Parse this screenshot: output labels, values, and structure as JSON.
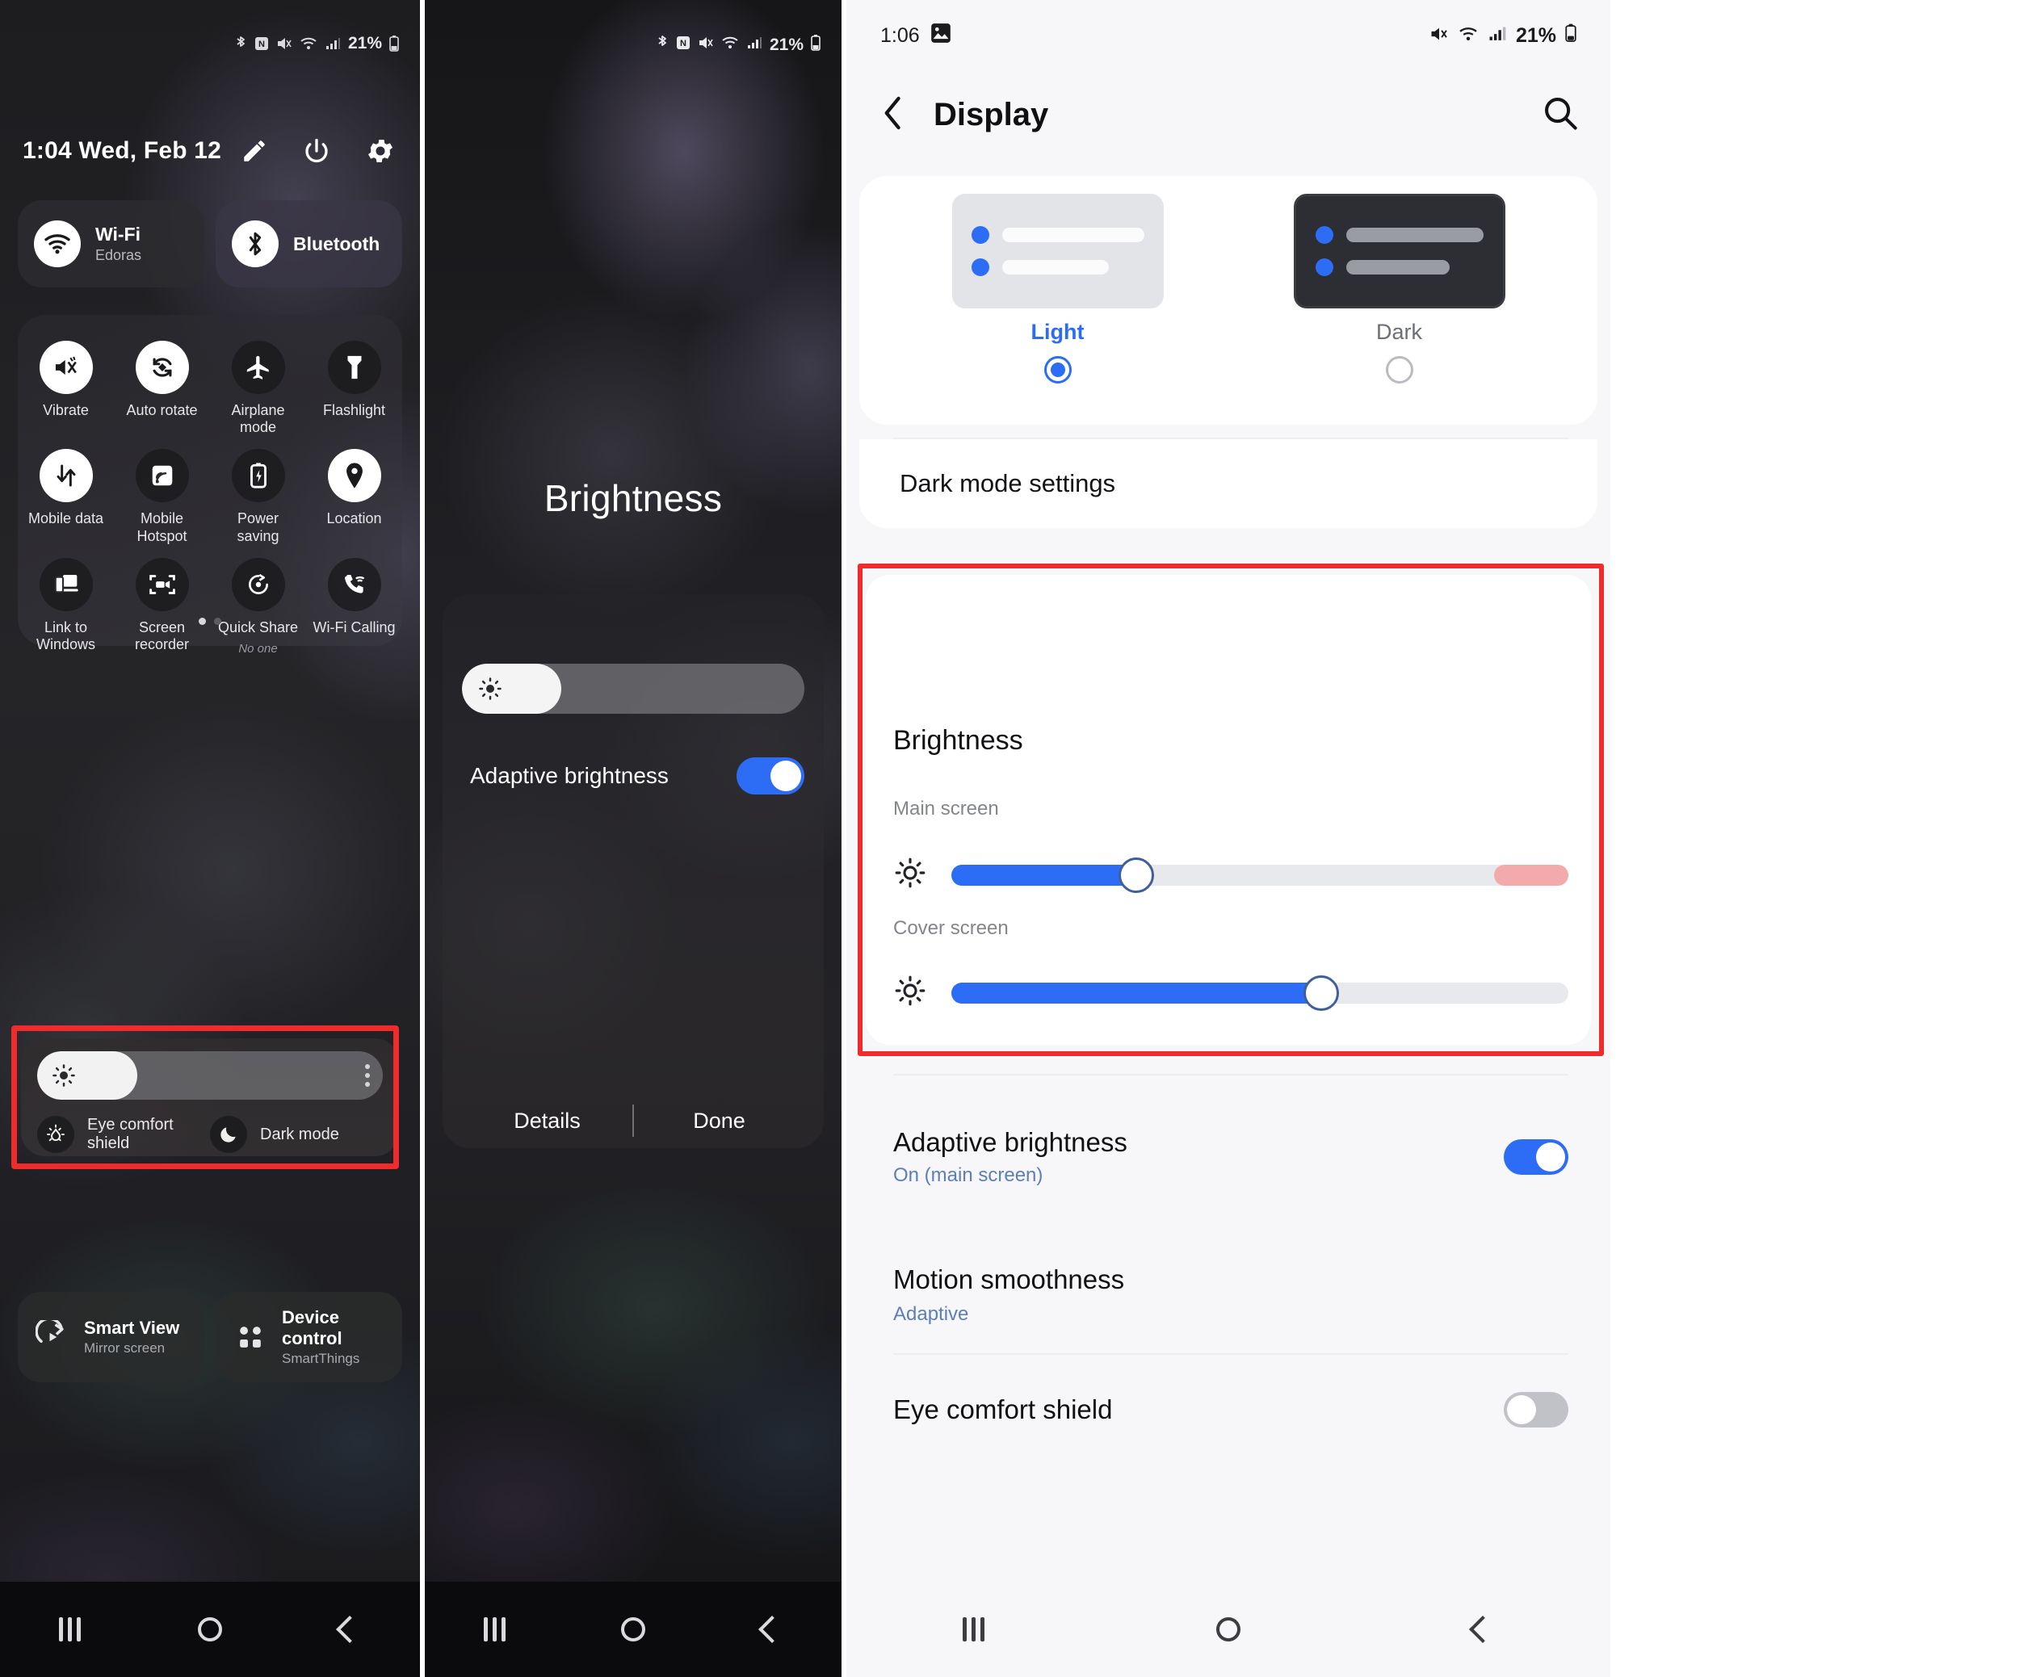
{
  "panel1": {
    "name": "quick-settings-panel",
    "statusbar": {
      "icons": [
        "bluetooth-icon",
        "nfc-icon",
        "mute-icon",
        "wifi-icon",
        "signal-icon"
      ],
      "battery_percent": "21%"
    },
    "clock": "1:04",
    "date": "Wed, Feb 12",
    "clock_line": "1:04  Wed, Feb 12",
    "top_actions": [
      {
        "name": "edit-pencil-icon",
        "label": "Edit"
      },
      {
        "name": "power-icon",
        "label": "Power"
      },
      {
        "name": "gear-icon",
        "label": "Settings"
      }
    ],
    "pills": [
      {
        "icon": "wifi-icon",
        "title": "Wi-Fi",
        "subtitle": "Edoras"
      },
      {
        "icon": "bluetooth-icon",
        "title": "Bluetooth",
        "subtitle": ""
      }
    ],
    "tiles": [
      {
        "icon": "vibrate-icon",
        "label": "Vibrate",
        "sub": "",
        "state": "on"
      },
      {
        "icon": "auto-rotate-icon",
        "label": "Auto rotate",
        "sub": "",
        "state": "on"
      },
      {
        "icon": "airplane-icon",
        "label": "Airplane mode",
        "sub": "",
        "state": "off"
      },
      {
        "icon": "flashlight-icon",
        "label": "Flashlight",
        "sub": "",
        "state": "off"
      },
      {
        "icon": "mobile-data-icon",
        "label": "Mobile data",
        "sub": "",
        "state": "on"
      },
      {
        "icon": "hotspot-icon",
        "label": "Mobile Hotspot",
        "sub": "",
        "state": "off"
      },
      {
        "icon": "power-saving-icon",
        "label": "Power saving",
        "sub": "",
        "state": "off"
      },
      {
        "icon": "location-icon",
        "label": "Location",
        "sub": "",
        "state": "on"
      },
      {
        "icon": "link-to-windows-icon",
        "label": "Link to Windows",
        "sub": "",
        "state": "off"
      },
      {
        "icon": "screen-recorder-icon",
        "label": "Screen recorder",
        "sub": "",
        "state": "off"
      },
      {
        "icon": "quick-share-icon",
        "label": "Quick Share",
        "sub": "No one",
        "state": "off"
      },
      {
        "icon": "wifi-calling-icon",
        "label": "Wi-Fi Calling",
        "sub": "",
        "state": "off"
      }
    ],
    "brightness": {
      "slider_value": 29,
      "slider_icon": "brightness-icon",
      "menu_icon": "more-vertical-icon",
      "modes": [
        {
          "icon": "eye-comfort-icon",
          "label": "Eye comfort shield"
        },
        {
          "icon": "moon-icon",
          "label": "Dark mode"
        }
      ],
      "highlighted": true,
      "highlight_color": "#ef2b2b"
    },
    "bottom_cards": [
      {
        "icon": "smart-view-icon",
        "title": "Smart View",
        "subtitle": "Mirror screen"
      },
      {
        "icon": "device-control-icon",
        "title": "Device control",
        "subtitle": "SmartThings"
      }
    ],
    "nav": [
      "recents-icon",
      "home-icon",
      "back-icon"
    ]
  },
  "panel2": {
    "name": "brightness-dialog-panel",
    "statusbar": {
      "icons": [
        "bluetooth-icon",
        "nfc-icon",
        "mute-icon",
        "wifi-icon",
        "signal-icon"
      ],
      "battery_percent": "21%"
    },
    "title": "Brightness",
    "slider_value": 29,
    "slider_icon": "brightness-icon",
    "adaptive": {
      "label": "Adaptive brightness",
      "toggle_state": "on",
      "highlighted": true,
      "highlight_color": "#ef2b2b"
    },
    "actions": [
      {
        "name": "details-button",
        "label": "Details"
      },
      {
        "name": "done-button",
        "label": "Done"
      }
    ],
    "nav": [
      "recents-icon",
      "home-icon",
      "back-icon"
    ]
  },
  "panel3": {
    "name": "display-settings-panel",
    "statusbar": {
      "time": "1:06",
      "left_icons": [
        "photo-icon"
      ],
      "right_icons": [
        "mute-icon",
        "wifi-icon",
        "signal-icon"
      ],
      "battery_percent": "21%"
    },
    "appbar": {
      "back_icon": "back-chevron-icon",
      "title": "Display",
      "search_icon": "search-icon"
    },
    "theme": {
      "options": [
        {
          "label": "Light",
          "selected": true
        },
        {
          "label": "Dark",
          "selected": false
        }
      ],
      "accent": "#2d6df6"
    },
    "dark_mode_settings": "Dark mode settings",
    "brightness": {
      "heading": "Brightness",
      "highlighted": true,
      "highlight_color": "#ef2b2b",
      "main_screen": {
        "label": "Main screen",
        "icon": "brightness-icon",
        "value": 30,
        "warn_zone_start": 88
      },
      "cover_screen": {
        "label": "Cover screen",
        "icon": "brightness-icon",
        "value": 60
      },
      "adaptive": {
        "title": "Adaptive brightness",
        "subtitle": "On (main screen)",
        "toggle_state": "on"
      }
    },
    "motion_smoothness": {
      "title": "Motion smoothness",
      "subtitle": "Adaptive"
    },
    "eye_comfort": {
      "title": "Eye comfort shield",
      "toggle_state": "off"
    },
    "nav": [
      "recents-icon",
      "home-icon",
      "back-icon"
    ]
  }
}
